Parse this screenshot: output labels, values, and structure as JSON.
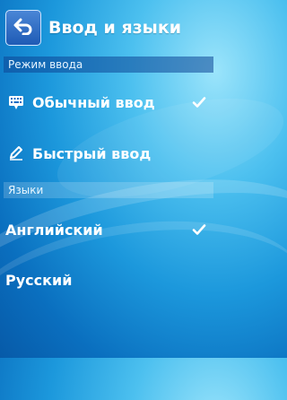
{
  "header": {
    "title": "Ввод и языки",
    "back_icon": "back-arrow-icon"
  },
  "input_section": {
    "heading": "Режим ввода",
    "items": [
      {
        "label": "Обычный ввод",
        "icon": "keypad-icon",
        "checked": true
      },
      {
        "label": "Быстрый ввод",
        "icon": "pencil-icon",
        "checked": false
      }
    ]
  },
  "languages_section": {
    "heading": "Языки",
    "items": [
      {
        "label": "Английский",
        "checked": true
      },
      {
        "label": "Русский",
        "checked": false
      }
    ]
  },
  "colors": {
    "accent": "#1f5bb5",
    "background": "#1c98dc"
  }
}
